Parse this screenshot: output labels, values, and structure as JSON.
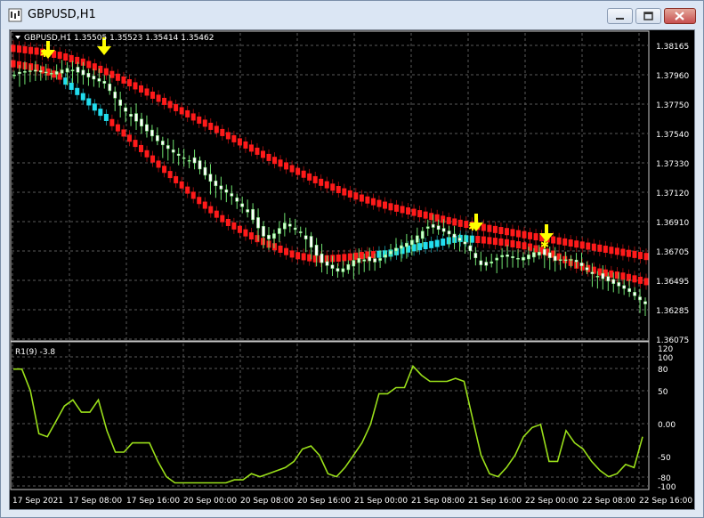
{
  "window": {
    "title": "GBPUSD,H1",
    "minimize_label": "minimize",
    "maximize_label": "maximize",
    "close_label": "close"
  },
  "colors": {
    "background": "#000000",
    "grid": "#5a5a5a",
    "bull_candle": "#ccffcc",
    "bear_candle": "#ffffff",
    "wick": "#6fe26f",
    "ma_band": "#ff1a1a",
    "cyan_dots": "#22ddee",
    "arrow": "#ffff00",
    "oscillator_line": "#9adf1a",
    "axis_text": "#ffffff"
  },
  "price_panel": {
    "header": "GBPUSD,H1  1.35505 1.35523 1.35414 1.35462",
    "price_ticks": [
      "1.38165",
      "1.37960",
      "1.37750",
      "1.37540",
      "1.37330",
      "1.37120",
      "1.36910",
      "1.36705",
      "1.36495",
      "1.36285",
      "1.36075"
    ]
  },
  "indicator_panel": {
    "header": "R1(9) -3.8",
    "ticks": [
      "120",
      "100",
      "80",
      "50",
      "0.00",
      "-50",
      "-80",
      "-100"
    ]
  },
  "time_axis": {
    "labels": [
      "17 Sep 2021",
      "17 Sep 08:00",
      "17 Sep 16:00",
      "20 Sep 00:00",
      "20 Sep 08:00",
      "20 Sep 16:00",
      "21 Sep 00:00",
      "21 Sep 08:00",
      "21 Sep 16:00",
      "22 Sep 00:00",
      "22 Sep 08:00",
      "22 Sep 16:00"
    ]
  },
  "chart_data": [
    {
      "type": "candlestick",
      "symbol": "GBPUSD",
      "timeframe": "H1",
      "ohlc_last": {
        "open": 1.35505,
        "high": 1.35523,
        "low": 1.35414,
        "close": 1.35462
      },
      "ylim": [
        1.36075,
        1.38165
      ],
      "x_labels": [
        "17 Sep 2021",
        "17 Sep 08:00",
        "17 Sep 16:00",
        "20 Sep 00:00",
        "20 Sep 08:00",
        "20 Sep 16:00",
        "21 Sep 00:00",
        "21 Sep 08:00",
        "21 Sep 16:00",
        "22 Sep 00:00",
        "22 Sep 08:00",
        "22 Sep 16:00"
      ],
      "close_series": [
        1.3796,
        1.3799,
        1.3797,
        1.3801,
        1.3795,
        1.379,
        1.3772,
        1.376,
        1.3748,
        1.3739,
        1.3733,
        1.3718,
        1.371,
        1.3697,
        1.3677,
        1.369,
        1.3682,
        1.3662,
        1.3655,
        1.3665,
        1.3662,
        1.3671,
        1.3677,
        1.3688,
        1.3683,
        1.3675,
        1.3658,
        1.3667,
        1.3664,
        1.367,
        1.3663,
        1.3664,
        1.3654,
        1.3648,
        1.3642,
        1.3632
      ],
      "upper_band": [
        1.3815,
        1.3813,
        1.381,
        1.3805,
        1.3798,
        1.379,
        1.3781,
        1.3772,
        1.3763,
        1.3754,
        1.3745,
        1.3736,
        1.3728,
        1.372,
        1.3713,
        1.3707,
        1.3702,
        1.3698,
        1.3694,
        1.369,
        1.3687,
        1.3684,
        1.3681,
        1.3678,
        1.3675,
        1.3672,
        1.3669,
        1.3666
      ],
      "lower_band": [
        1.3804,
        1.3801,
        1.3795,
        1.378,
        1.3765,
        1.375,
        1.3735,
        1.372,
        1.3705,
        1.3692,
        1.3682,
        1.3674,
        1.3667,
        1.3664,
        1.3665,
        1.3667,
        1.3668,
        1.3672,
        1.3675,
        1.3679,
        1.3678,
        1.3676,
        1.3673,
        1.3668,
        1.366,
        1.3655,
        1.3652,
        1.3648
      ]
    },
    {
      "type": "line",
      "name": "R1(9)",
      "last_value": -3.8,
      "ylim": [
        -100,
        120
      ],
      "values": [
        90,
        90,
        55,
        -15,
        -20,
        5,
        30,
        40,
        20,
        20,
        40,
        -10,
        -45,
        -45,
        -30,
        -30,
        -30,
        -60,
        -85,
        -95,
        -95,
        -95,
        -95,
        -95,
        -95,
        -95,
        -90,
        -90,
        -80,
        -85,
        -80,
        -75,
        -70,
        -60,
        -40,
        -35,
        -50,
        -80,
        -85,
        -70,
        -50,
        -30,
        0,
        50,
        50,
        60,
        60,
        95,
        80,
        70,
        70,
        70,
        75,
        70,
        10,
        -50,
        -80,
        -85,
        -70,
        -50,
        -20,
        -5,
        0,
        -60,
        -60,
        -10,
        -30,
        -40,
        -60,
        -75,
        -85,
        -80,
        -65,
        -70,
        -20
      ]
    }
  ]
}
